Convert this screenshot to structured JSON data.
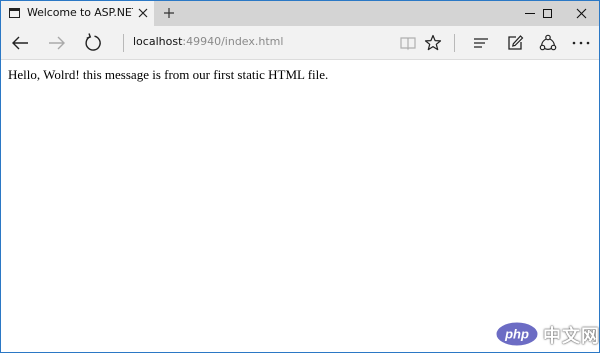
{
  "browser": {
    "tab": {
      "title": "Welcome to ASP.NET Co",
      "page_icon": "page-icon",
      "close_icon": "close-icon"
    },
    "new_tab_icon": "plus-icon",
    "window_controls": [
      "minimize-icon",
      "maximize-icon",
      "close-icon"
    ],
    "navigation": [
      "back-arrow-icon",
      "forward-arrow-icon",
      "refresh-icon"
    ],
    "address": {
      "host": "localhost",
      "rest": ":49940/index.html"
    },
    "toolbar": [
      "reading-view-icon",
      "star-icon",
      "hub-icon",
      "web-note-icon",
      "share-icon",
      "more-icon"
    ]
  },
  "page": {
    "message": "Hello, Wolrd! this message is from our first static HTML file."
  },
  "watermark": {
    "logo": "php",
    "text": "中文网",
    "color": "#6c6cc4"
  }
}
